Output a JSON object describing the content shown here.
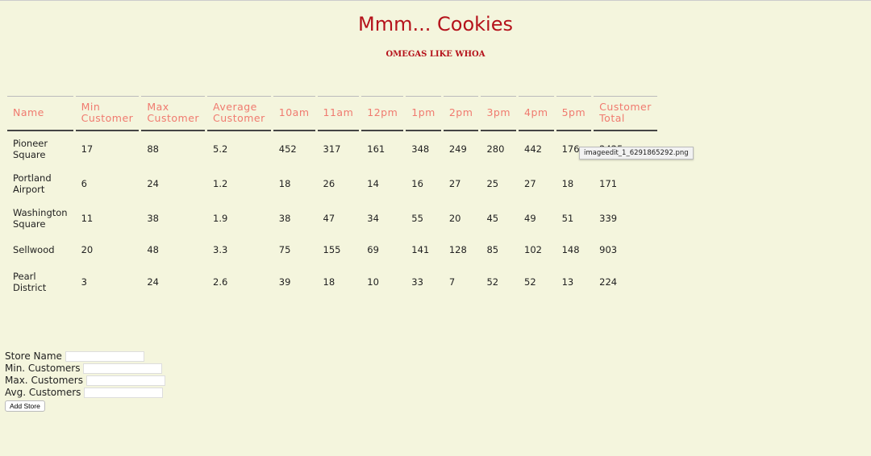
{
  "title": "Mmm... Cookies",
  "subtitle": "OMEGAS LIKE WHOA",
  "table": {
    "headers": [
      [
        "Name",
        ""
      ],
      [
        "Min",
        "Customer"
      ],
      [
        "Max",
        "Customer"
      ],
      [
        "Average",
        "Customer"
      ],
      [
        "10am",
        ""
      ],
      [
        "11am",
        ""
      ],
      [
        "12pm",
        ""
      ],
      [
        "1pm",
        ""
      ],
      [
        "2pm",
        ""
      ],
      [
        "3pm",
        ""
      ],
      [
        "4pm",
        ""
      ],
      [
        "5pm",
        ""
      ],
      [
        "Customer",
        "Total"
      ]
    ],
    "rows": [
      {
        "name": [
          "Pioneer",
          "Square"
        ],
        "cells": [
          "17",
          "88",
          "5.2",
          "452",
          "317",
          "161",
          "348",
          "249",
          "280",
          "442",
          "176",
          "2425"
        ]
      },
      {
        "name": [
          "Portland",
          "Airport"
        ],
        "cells": [
          "6",
          "24",
          "1.2",
          "18",
          "26",
          "14",
          "16",
          "27",
          "25",
          "27",
          "18",
          "171"
        ]
      },
      {
        "name": [
          "Washington",
          "Square"
        ],
        "cells": [
          "11",
          "38",
          "1.9",
          "38",
          "47",
          "34",
          "55",
          "20",
          "45",
          "49",
          "51",
          "339"
        ]
      },
      {
        "name": [
          "Sellwood",
          ""
        ],
        "cells": [
          "20",
          "48",
          "3.3",
          "75",
          "155",
          "69",
          "141",
          "128",
          "85",
          "102",
          "148",
          "903"
        ]
      },
      {
        "name": [
          "Pearl",
          "District"
        ],
        "cells": [
          "3",
          "24",
          "2.6",
          "39",
          "18",
          "10",
          "33",
          "7",
          "52",
          "52",
          "13",
          "224"
        ]
      }
    ]
  },
  "tooltip": "imageedit_1_6291865292.png",
  "form": {
    "store_name": "Store Name",
    "min": "Min. Customers",
    "max": "Max. Customers",
    "avg": "Avg. Customers",
    "submit": "Add Store"
  }
}
